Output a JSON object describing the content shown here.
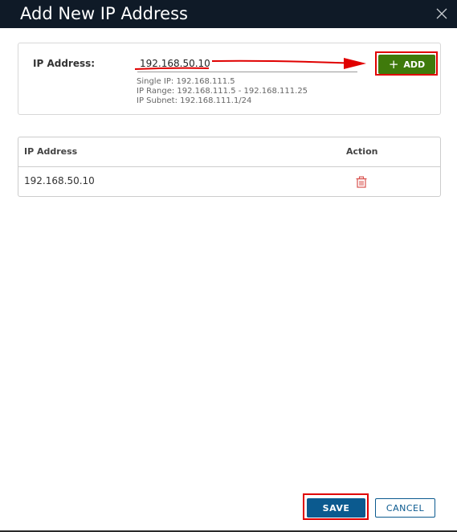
{
  "dialog": {
    "title": "Add New IP Address",
    "close_icon": "close-icon"
  },
  "form": {
    "ip_label": "IP Address:",
    "ip_value": "192.168.50.10",
    "hints": [
      "Single IP: 192.168.111.5",
      "IP Range: 192.168.111.5 - 192.168.111.25",
      "IP Subnet: 192.168.111.1/24"
    ],
    "add_label": "ADD",
    "add_icon": "plus-icon"
  },
  "table": {
    "columns": [
      "IP Address",
      "Action"
    ],
    "rows": [
      {
        "ip": "192.168.50.10",
        "action_icon": "trash-icon"
      }
    ]
  },
  "footer": {
    "save_label": "SAVE",
    "cancel_label": "CANCEL"
  },
  "colors": {
    "header_bg": "#0f1a27",
    "add_button": "#3f7a0b",
    "save_button": "#0b5a8f",
    "annotation": "#e00000",
    "delete_icon": "#d9534f"
  }
}
